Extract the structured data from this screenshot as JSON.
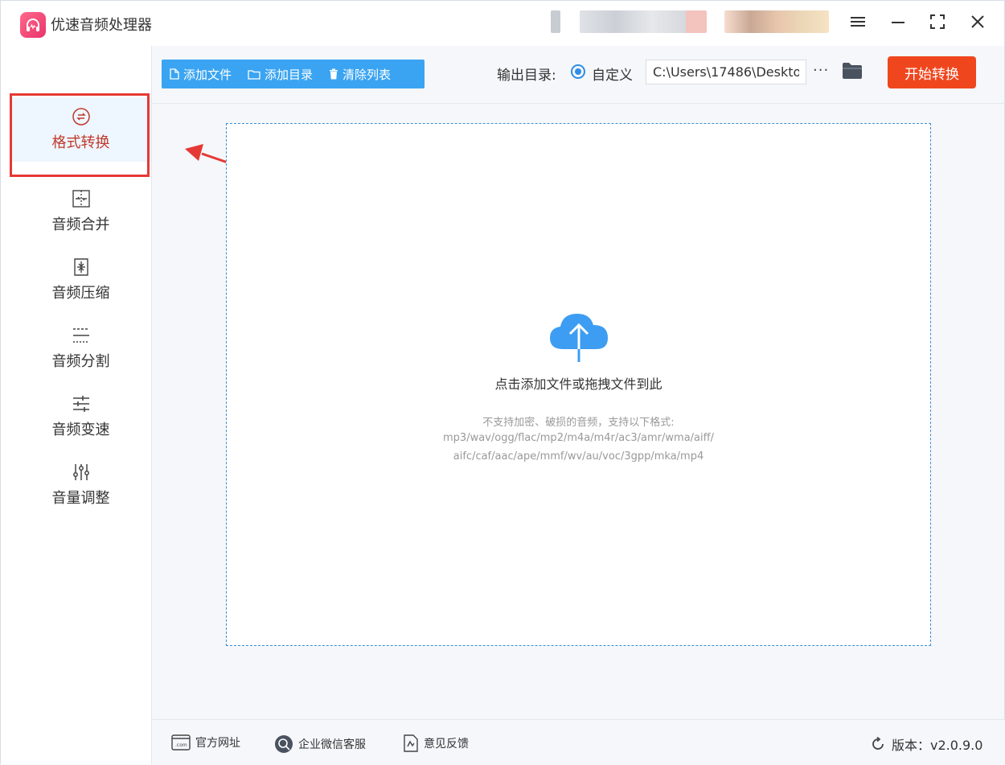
{
  "app": {
    "title": "优速音频处理器"
  },
  "sidebar": {
    "items": [
      {
        "label": "格式转换",
        "icon": "format-convert-icon",
        "active": true
      },
      {
        "label": "音频合并",
        "icon": "merge-icon"
      },
      {
        "label": "音频压缩",
        "icon": "compress-icon"
      },
      {
        "label": "音频分割",
        "icon": "split-icon"
      },
      {
        "label": "音频变速",
        "icon": "speed-icon"
      },
      {
        "label": "音量调整",
        "icon": "volume-icon"
      }
    ]
  },
  "toolbar": {
    "add_file": "添加文件",
    "add_dir": "添加目录",
    "clear_list": "清除列表",
    "output_label": "输出目录:",
    "custom_label": "自定义",
    "path_value": "C:\\Users\\17486\\Deskto",
    "more": "···",
    "start": "开始转换"
  },
  "dropzone": {
    "main_text": "点击添加文件或拖拽文件到此",
    "hint_line1": "不支持加密、破损的音频，支持以下格式:",
    "hint_line2": "mp3/wav/ogg/flac/mp2/m4a/m4r/ac3/amr/wma/aiff/",
    "hint_line3": "aifc/caf/aac/ape/mmf/wv/au/voc/3gpp/mka/mp4"
  },
  "footer": {
    "website": "官方网址",
    "wechat": "企业微信客服",
    "feedback": "意见反馈",
    "version": "版本：v2.0.9.0"
  },
  "colors": {
    "accent": "#3aa4f2",
    "start": "#f0461e",
    "highlight": "#e53935",
    "active_text": "#c0392b"
  }
}
